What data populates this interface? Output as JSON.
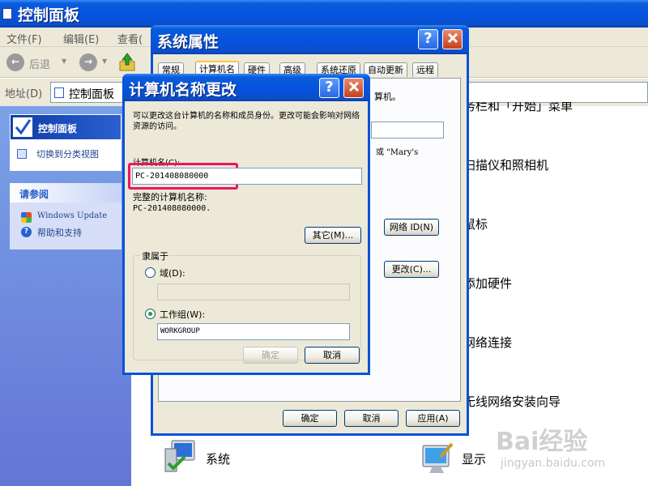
{
  "control_panel": {
    "title": "控制面板",
    "menu": [
      "文件(F)",
      "编辑(E)",
      "查看("
    ],
    "toolbar": {
      "back_label": "后退"
    },
    "address": {
      "label": "地址(D)",
      "value": "控制面板"
    },
    "sidebar": {
      "panel_title": "控制面板",
      "switch_view": "切换到分类视图",
      "see_also_title": "请参阅",
      "links": [
        "Windows Update",
        "帮助和支持"
      ]
    },
    "categories": [
      "务栏和「开始」菜单",
      "扫描仪和照相机",
      "鼠标",
      "添加硬件",
      "网络连接",
      "无线网络安装向导"
    ],
    "bottom_items": {
      "system": "系统",
      "display": "显示"
    }
  },
  "system_properties": {
    "title": "系统属性",
    "tabs": [
      "常规",
      "计算机名",
      "硬件",
      "高级",
      "系统还原",
      "自动更新",
      "远程"
    ],
    "partial_text_1": "算机。",
    "partial_text_2": "或 \"Mary's",
    "network_id_button": "网络 ID(N)",
    "change_button": "更改(C)...",
    "ok": "确定",
    "cancel": "取消",
    "apply": "应用(A)"
  },
  "rename_dialog": {
    "title": "计算机名称更改",
    "description": "可以更改这台计算机的名称和成员身份。更改可能会影响对网络资源的访问。",
    "computer_name_label": "计算机名(C):",
    "computer_name_value": "PC-201408080000",
    "full_name_label": "完整的计算机名称:",
    "full_name_value": "PC-201408080000.",
    "more_button": "其它(M)...",
    "member_of_label": "隶属于",
    "domain_label": "域(D):",
    "domain_value": "",
    "workgroup_label": "工作组(W):",
    "workgroup_value": "WORKGROUP",
    "ok": "确定",
    "cancel": "取消"
  },
  "watermark": {
    "brand": "Bai经验",
    "url": "jingyan.baidu.com"
  },
  "colors": {
    "xp_blue": "#0553dd",
    "highlight": "#e8175d",
    "dialog_face": "#ece9d8"
  }
}
